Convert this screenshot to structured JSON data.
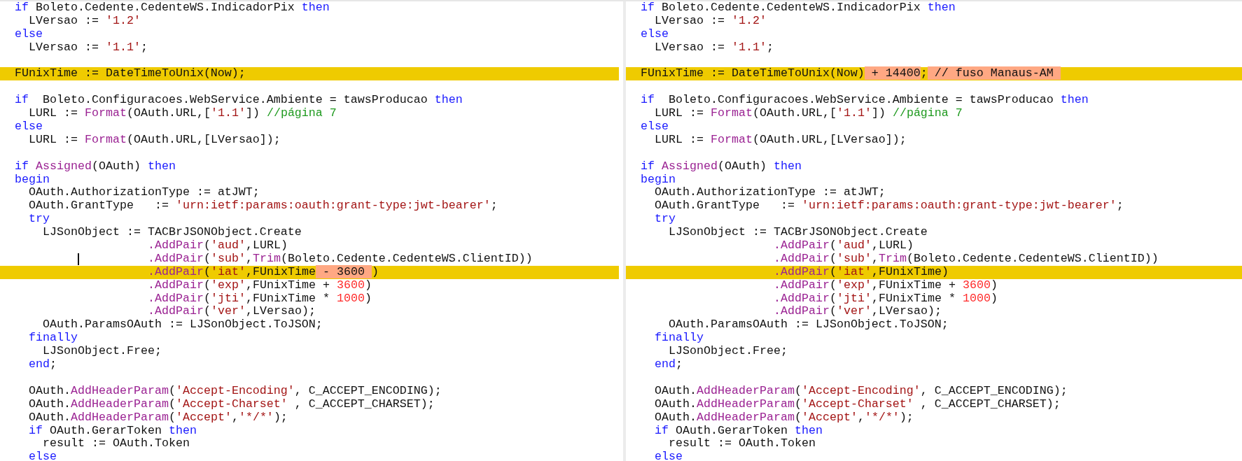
{
  "panes": [
    {
      "lines": [
        {
          "changed": false,
          "tokens": [
            {
              "kind": "kw",
              "text": "if"
            },
            {
              "kind": "txt",
              "text": " Boleto.Cedente.CedenteWS.IndicadorPix "
            },
            {
              "kind": "kw",
              "text": "then"
            }
          ]
        },
        {
          "changed": false,
          "tokens": [
            {
              "kind": "txt",
              "text": "  LVersao := "
            },
            {
              "kind": "str",
              "text": "'1.2'"
            }
          ]
        },
        {
          "changed": false,
          "tokens": [
            {
              "kind": "kw",
              "text": "else"
            }
          ]
        },
        {
          "changed": false,
          "tokens": [
            {
              "kind": "txt",
              "text": "  LVersao := "
            },
            {
              "kind": "str",
              "text": "'1.1'"
            },
            {
              "kind": "txt",
              "text": ";"
            }
          ]
        },
        {
          "changed": false
        },
        {
          "changed": true,
          "tokens": [
            {
              "kind": "txt",
              "text": "FUnixTime := DateTimeToUnix(Now);"
            }
          ]
        },
        {
          "changed": false
        },
        {
          "changed": false,
          "tokens": [
            {
              "kind": "kw",
              "text": "if"
            },
            {
              "kind": "txt",
              "text": "  Boleto.Configuracoes.WebService.Ambiente = tawsProducao "
            },
            {
              "kind": "kw",
              "text": "then"
            }
          ]
        },
        {
          "changed": false,
          "tokens": [
            {
              "kind": "txt",
              "text": "  LURL := "
            },
            {
              "kind": "fn",
              "text": "Format"
            },
            {
              "kind": "txt",
              "text": "(OAuth.URL,["
            },
            {
              "kind": "str",
              "text": "'1.1'"
            },
            {
              "kind": "txt",
              "text": "]) "
            },
            {
              "kind": "cmt",
              "text": "//página 7"
            }
          ]
        },
        {
          "changed": false,
          "tokens": [
            {
              "kind": "kw",
              "text": "else"
            }
          ]
        },
        {
          "changed": false,
          "tokens": [
            {
              "kind": "txt",
              "text": "  LURL := "
            },
            {
              "kind": "fn",
              "text": "Format"
            },
            {
              "kind": "txt",
              "text": "(OAuth.URL,[LVersao]);"
            }
          ]
        },
        {
          "changed": false
        },
        {
          "changed": false,
          "tokens": [
            {
              "kind": "kw",
              "text": "if"
            },
            {
              "kind": "fn",
              "text": " Assigned"
            },
            {
              "kind": "txt",
              "text": "(OAuth) "
            },
            {
              "kind": "kw",
              "text": "then"
            }
          ]
        },
        {
          "changed": false,
          "tokens": [
            {
              "kind": "kw",
              "text": "begin"
            }
          ]
        },
        {
          "changed": false,
          "tokens": [
            {
              "kind": "txt",
              "text": "  OAuth.AuthorizationType := atJWT;"
            }
          ]
        },
        {
          "changed": false,
          "tokens": [
            {
              "kind": "txt",
              "text": "  OAuth.GrantType   := "
            },
            {
              "kind": "str",
              "text": "'urn:ietf:params:oauth:grant-type:jwt-bearer'"
            },
            {
              "kind": "txt",
              "text": ";"
            }
          ]
        },
        {
          "changed": false,
          "tokens": [
            {
              "kind": "kw",
              "text": "  try"
            }
          ]
        },
        {
          "changed": false,
          "tokens": [
            {
              "kind": "txt",
              "text": "    LJSonObject := TACBrJSONObject.Create"
            }
          ]
        },
        {
          "changed": false,
          "tokens": [
            {
              "kind": "fn",
              "text": "                   .AddPair"
            },
            {
              "kind": "txt",
              "text": "("
            },
            {
              "kind": "str",
              "text": "'aud'"
            },
            {
              "kind": "txt",
              "text": ",LURL)"
            }
          ]
        },
        {
          "changed": false,
          "cursor": true,
          "tokens": [
            {
              "kind": "fn",
              "text": "                   .AddPair"
            },
            {
              "kind": "txt",
              "text": "("
            },
            {
              "kind": "str",
              "text": "'sub'"
            },
            {
              "kind": "txt",
              "text": ","
            },
            {
              "kind": "fn",
              "text": "Trim"
            },
            {
              "kind": "txt",
              "text": "(Boleto.Cedente.CedenteWS.ClientID))"
            }
          ]
        },
        {
          "changed": true,
          "tokens": [
            {
              "kind": "fn",
              "text": "                   .AddPair"
            },
            {
              "kind": "txt",
              "text": "("
            },
            {
              "kind": "str",
              "text": "'iat'"
            },
            {
              "kind": "txt",
              "text": ",FUnixTime"
            },
            {
              "kind": "diff",
              "text": " - 3600 "
            },
            {
              "kind": "txt",
              "text": ")"
            }
          ]
        },
        {
          "changed": false,
          "tokens": [
            {
              "kind": "fn",
              "text": "                   .AddPair"
            },
            {
              "kind": "txt",
              "text": "("
            },
            {
              "kind": "str",
              "text": "'exp'"
            },
            {
              "kind": "txt",
              "text": ",FUnixTime + "
            },
            {
              "kind": "num",
              "text": "3600"
            },
            {
              "kind": "txt",
              "text": ")"
            }
          ]
        },
        {
          "changed": false,
          "tokens": [
            {
              "kind": "fn",
              "text": "                   .AddPair"
            },
            {
              "kind": "txt",
              "text": "("
            },
            {
              "kind": "str",
              "text": "'jti'"
            },
            {
              "kind": "txt",
              "text": ",FUnixTime * "
            },
            {
              "kind": "num",
              "text": "1000"
            },
            {
              "kind": "txt",
              "text": ")"
            }
          ]
        },
        {
          "changed": false,
          "tokens": [
            {
              "kind": "fn",
              "text": "                   .AddPair"
            },
            {
              "kind": "txt",
              "text": "("
            },
            {
              "kind": "str",
              "text": "'ver'"
            },
            {
              "kind": "txt",
              "text": ",LVersao);"
            }
          ]
        },
        {
          "changed": false,
          "tokens": [
            {
              "kind": "txt",
              "text": "    OAuth.ParamsOAuth := LJSonObject.ToJSON;"
            }
          ]
        },
        {
          "changed": false,
          "tokens": [
            {
              "kind": "kw",
              "text": "  finally"
            }
          ]
        },
        {
          "changed": false,
          "tokens": [
            {
              "kind": "txt",
              "text": "    LJSonObject.Free;"
            }
          ]
        },
        {
          "changed": false,
          "tokens": [
            {
              "kind": "kw",
              "text": "  end"
            },
            {
              "kind": "txt",
              "text": ";"
            }
          ]
        },
        {
          "changed": false
        },
        {
          "changed": false,
          "tokens": [
            {
              "kind": "txt",
              "text": "  OAuth."
            },
            {
              "kind": "fn",
              "text": "AddHeaderParam"
            },
            {
              "kind": "txt",
              "text": "("
            },
            {
              "kind": "str",
              "text": "'Accept-Encoding'"
            },
            {
              "kind": "txt",
              "text": ", C_ACCEPT_ENCODING);"
            }
          ]
        },
        {
          "changed": false,
          "tokens": [
            {
              "kind": "txt",
              "text": "  OAuth."
            },
            {
              "kind": "fn",
              "text": "AddHeaderParam"
            },
            {
              "kind": "txt",
              "text": "("
            },
            {
              "kind": "str",
              "text": "'Accept-Charset'"
            },
            {
              "kind": "txt",
              "text": " , C_ACCEPT_CHARSET);"
            }
          ]
        },
        {
          "changed": false,
          "tokens": [
            {
              "kind": "txt",
              "text": "  OAuth."
            },
            {
              "kind": "fn",
              "text": "AddHeaderParam"
            },
            {
              "kind": "txt",
              "text": "("
            },
            {
              "kind": "str",
              "text": "'Accept'"
            },
            {
              "kind": "txt",
              "text": ","
            },
            {
              "kind": "str",
              "text": "'*/*'"
            },
            {
              "kind": "txt",
              "text": ");"
            }
          ]
        },
        {
          "changed": false,
          "tokens": [
            {
              "kind": "kw",
              "text": "  if"
            },
            {
              "kind": "txt",
              "text": " OAuth.GerarToken "
            },
            {
              "kind": "kw",
              "text": "then"
            }
          ]
        },
        {
          "changed": false,
          "tokens": [
            {
              "kind": "txt",
              "text": "    result := OAuth.Token"
            }
          ]
        },
        {
          "changed": false,
          "tokens": [
            {
              "kind": "kw",
              "text": "  else"
            }
          ]
        }
      ]
    },
    {
      "lines": [
        {
          "changed": false,
          "tokens": [
            {
              "kind": "kw",
              "text": "if"
            },
            {
              "kind": "txt",
              "text": " Boleto.Cedente.CedenteWS.IndicadorPix "
            },
            {
              "kind": "kw",
              "text": "then"
            }
          ]
        },
        {
          "changed": false,
          "tokens": [
            {
              "kind": "txt",
              "text": "  LVersao := "
            },
            {
              "kind": "str",
              "text": "'1.2'"
            }
          ]
        },
        {
          "changed": false,
          "tokens": [
            {
              "kind": "kw",
              "text": "else"
            }
          ]
        },
        {
          "changed": false,
          "tokens": [
            {
              "kind": "txt",
              "text": "  LVersao := "
            },
            {
              "kind": "str",
              "text": "'1.1'"
            },
            {
              "kind": "txt",
              "text": ";"
            }
          ]
        },
        {
          "changed": false
        },
        {
          "changed": true,
          "tokens": [
            {
              "kind": "txt",
              "text": "FUnixTime := DateTimeToUnix(Now)"
            },
            {
              "kind": "diff",
              "text": " + 14400"
            },
            {
              "kind": "txt",
              "text": ";"
            },
            {
              "kind": "diff",
              "text": " // fuso Manaus-AM "
            }
          ]
        },
        {
          "changed": false
        },
        {
          "changed": false,
          "tokens": [
            {
              "kind": "kw",
              "text": "if"
            },
            {
              "kind": "txt",
              "text": "  Boleto.Configuracoes.WebService.Ambiente = tawsProducao "
            },
            {
              "kind": "kw",
              "text": "then"
            }
          ]
        },
        {
          "changed": false,
          "tokens": [
            {
              "kind": "txt",
              "text": "  LURL := "
            },
            {
              "kind": "fn",
              "text": "Format"
            },
            {
              "kind": "txt",
              "text": "(OAuth.URL,["
            },
            {
              "kind": "str",
              "text": "'1.1'"
            },
            {
              "kind": "txt",
              "text": "]) "
            },
            {
              "kind": "cmt",
              "text": "//página 7"
            }
          ]
        },
        {
          "changed": false,
          "tokens": [
            {
              "kind": "kw",
              "text": "else"
            }
          ]
        },
        {
          "changed": false,
          "tokens": [
            {
              "kind": "txt",
              "text": "  LURL := "
            },
            {
              "kind": "fn",
              "text": "Format"
            },
            {
              "kind": "txt",
              "text": "(OAuth.URL,[LVersao]);"
            }
          ]
        },
        {
          "changed": false
        },
        {
          "changed": false,
          "tokens": [
            {
              "kind": "kw",
              "text": "if"
            },
            {
              "kind": "fn",
              "text": " Assigned"
            },
            {
              "kind": "txt",
              "text": "(OAuth) "
            },
            {
              "kind": "kw",
              "text": "then"
            }
          ]
        },
        {
          "changed": false,
          "tokens": [
            {
              "kind": "kw",
              "text": "begin"
            }
          ]
        },
        {
          "changed": false,
          "tokens": [
            {
              "kind": "txt",
              "text": "  OAuth.AuthorizationType := atJWT;"
            }
          ]
        },
        {
          "changed": false,
          "tokens": [
            {
              "kind": "txt",
              "text": "  OAuth.GrantType   := "
            },
            {
              "kind": "str",
              "text": "'urn:ietf:params:oauth:grant-type:jwt-bearer'"
            },
            {
              "kind": "txt",
              "text": ";"
            }
          ]
        },
        {
          "changed": false,
          "tokens": [
            {
              "kind": "kw",
              "text": "  try"
            }
          ]
        },
        {
          "changed": false,
          "tokens": [
            {
              "kind": "txt",
              "text": "    LJSonObject := TACBrJSONObject.Create"
            }
          ]
        },
        {
          "changed": false,
          "tokens": [
            {
              "kind": "fn",
              "text": "                   .AddPair"
            },
            {
              "kind": "txt",
              "text": "("
            },
            {
              "kind": "str",
              "text": "'aud'"
            },
            {
              "kind": "txt",
              "text": ",LURL)"
            }
          ]
        },
        {
          "changed": false,
          "tokens": [
            {
              "kind": "fn",
              "text": "                   .AddPair"
            },
            {
              "kind": "txt",
              "text": "("
            },
            {
              "kind": "str",
              "text": "'sub'"
            },
            {
              "kind": "txt",
              "text": ","
            },
            {
              "kind": "fn",
              "text": "Trim"
            },
            {
              "kind": "txt",
              "text": "(Boleto.Cedente.CedenteWS.ClientID))"
            }
          ]
        },
        {
          "changed": true,
          "tokens": [
            {
              "kind": "fn",
              "text": "                   .AddPair"
            },
            {
              "kind": "txt",
              "text": "("
            },
            {
              "kind": "str",
              "text": "'iat'"
            },
            {
              "kind": "txt",
              "text": ",FUnixTime)"
            }
          ]
        },
        {
          "changed": false,
          "tokens": [
            {
              "kind": "fn",
              "text": "                   .AddPair"
            },
            {
              "kind": "txt",
              "text": "("
            },
            {
              "kind": "str",
              "text": "'exp'"
            },
            {
              "kind": "txt",
              "text": ",FUnixTime + "
            },
            {
              "kind": "num",
              "text": "3600"
            },
            {
              "kind": "txt",
              "text": ")"
            }
          ]
        },
        {
          "changed": false,
          "tokens": [
            {
              "kind": "fn",
              "text": "                   .AddPair"
            },
            {
              "kind": "txt",
              "text": "("
            },
            {
              "kind": "str",
              "text": "'jti'"
            },
            {
              "kind": "txt",
              "text": ",FUnixTime * "
            },
            {
              "kind": "num",
              "text": "1000"
            },
            {
              "kind": "txt",
              "text": ")"
            }
          ]
        },
        {
          "changed": false,
          "tokens": [
            {
              "kind": "fn",
              "text": "                   .AddPair"
            },
            {
              "kind": "txt",
              "text": "("
            },
            {
              "kind": "str",
              "text": "'ver'"
            },
            {
              "kind": "txt",
              "text": ",LVersao);"
            }
          ]
        },
        {
          "changed": false,
          "tokens": [
            {
              "kind": "txt",
              "text": "    OAuth.ParamsOAuth := LJSonObject.ToJSON;"
            }
          ]
        },
        {
          "changed": false,
          "tokens": [
            {
              "kind": "kw",
              "text": "  finally"
            }
          ]
        },
        {
          "changed": false,
          "tokens": [
            {
              "kind": "txt",
              "text": "    LJSonObject.Free;"
            }
          ]
        },
        {
          "changed": false,
          "tokens": [
            {
              "kind": "kw",
              "text": "  end"
            },
            {
              "kind": "txt",
              "text": ";"
            }
          ]
        },
        {
          "changed": false
        },
        {
          "changed": false,
          "tokens": [
            {
              "kind": "txt",
              "text": "  OAuth."
            },
            {
              "kind": "fn",
              "text": "AddHeaderParam"
            },
            {
              "kind": "txt",
              "text": "("
            },
            {
              "kind": "str",
              "text": "'Accept-Encoding'"
            },
            {
              "kind": "txt",
              "text": ", C_ACCEPT_ENCODING);"
            }
          ]
        },
        {
          "changed": false,
          "tokens": [
            {
              "kind": "txt",
              "text": "  OAuth."
            },
            {
              "kind": "fn",
              "text": "AddHeaderParam"
            },
            {
              "kind": "txt",
              "text": "("
            },
            {
              "kind": "str",
              "text": "'Accept-Charset'"
            },
            {
              "kind": "txt",
              "text": " , C_ACCEPT_CHARSET);"
            }
          ]
        },
        {
          "changed": false,
          "tokens": [
            {
              "kind": "txt",
              "text": "  OAuth."
            },
            {
              "kind": "fn",
              "text": "AddHeaderParam"
            },
            {
              "kind": "txt",
              "text": "("
            },
            {
              "kind": "str",
              "text": "'Accept'"
            },
            {
              "kind": "txt",
              "text": ","
            },
            {
              "kind": "str",
              "text": "'*/*'"
            },
            {
              "kind": "txt",
              "text": ");"
            }
          ]
        },
        {
          "changed": false,
          "tokens": [
            {
              "kind": "kw",
              "text": "  if"
            },
            {
              "kind": "txt",
              "text": " OAuth.GerarToken "
            },
            {
              "kind": "kw",
              "text": "then"
            }
          ]
        },
        {
          "changed": false,
          "tokens": [
            {
              "kind": "txt",
              "text": "    result := OAuth.Token"
            }
          ]
        },
        {
          "changed": false,
          "tokens": [
            {
              "kind": "kw",
              "text": "  else"
            }
          ]
        }
      ]
    }
  ]
}
